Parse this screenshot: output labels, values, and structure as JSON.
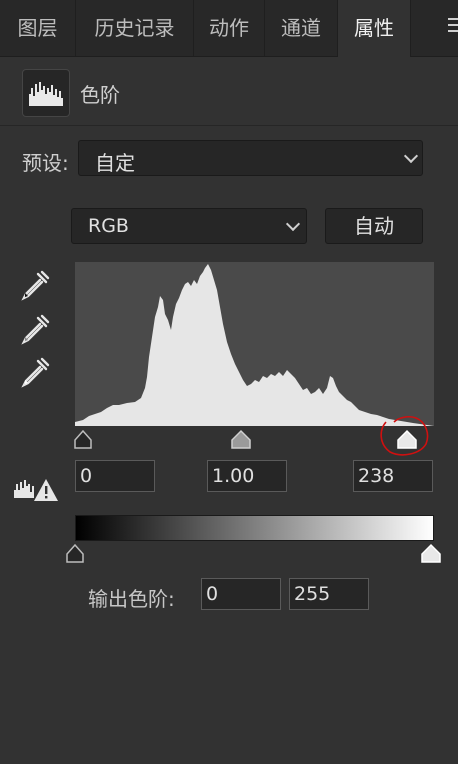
{
  "tabs": [
    {
      "label": "图层",
      "active": false
    },
    {
      "label": "历史记录",
      "active": false
    },
    {
      "label": "动作",
      "active": false
    },
    {
      "label": "通道",
      "active": false
    },
    {
      "label": "属性",
      "active": true
    }
  ],
  "adjustment": {
    "title": "色阶",
    "icon": "levels-histogram-icon"
  },
  "preset": {
    "label": "预设:",
    "value": "自定"
  },
  "channel": {
    "value": "RGB",
    "auto_label": "自动"
  },
  "input_levels": {
    "black": "0",
    "gamma": "1.00",
    "white": "238"
  },
  "output_levels": {
    "label": "输出色阶:",
    "black": "0",
    "white": "255"
  },
  "colors": {
    "panel_bg": "#323232",
    "histogram_bg": "#4a4a4a",
    "histogram_fill": "#e6e6e6",
    "annotation": "#d01010"
  }
}
